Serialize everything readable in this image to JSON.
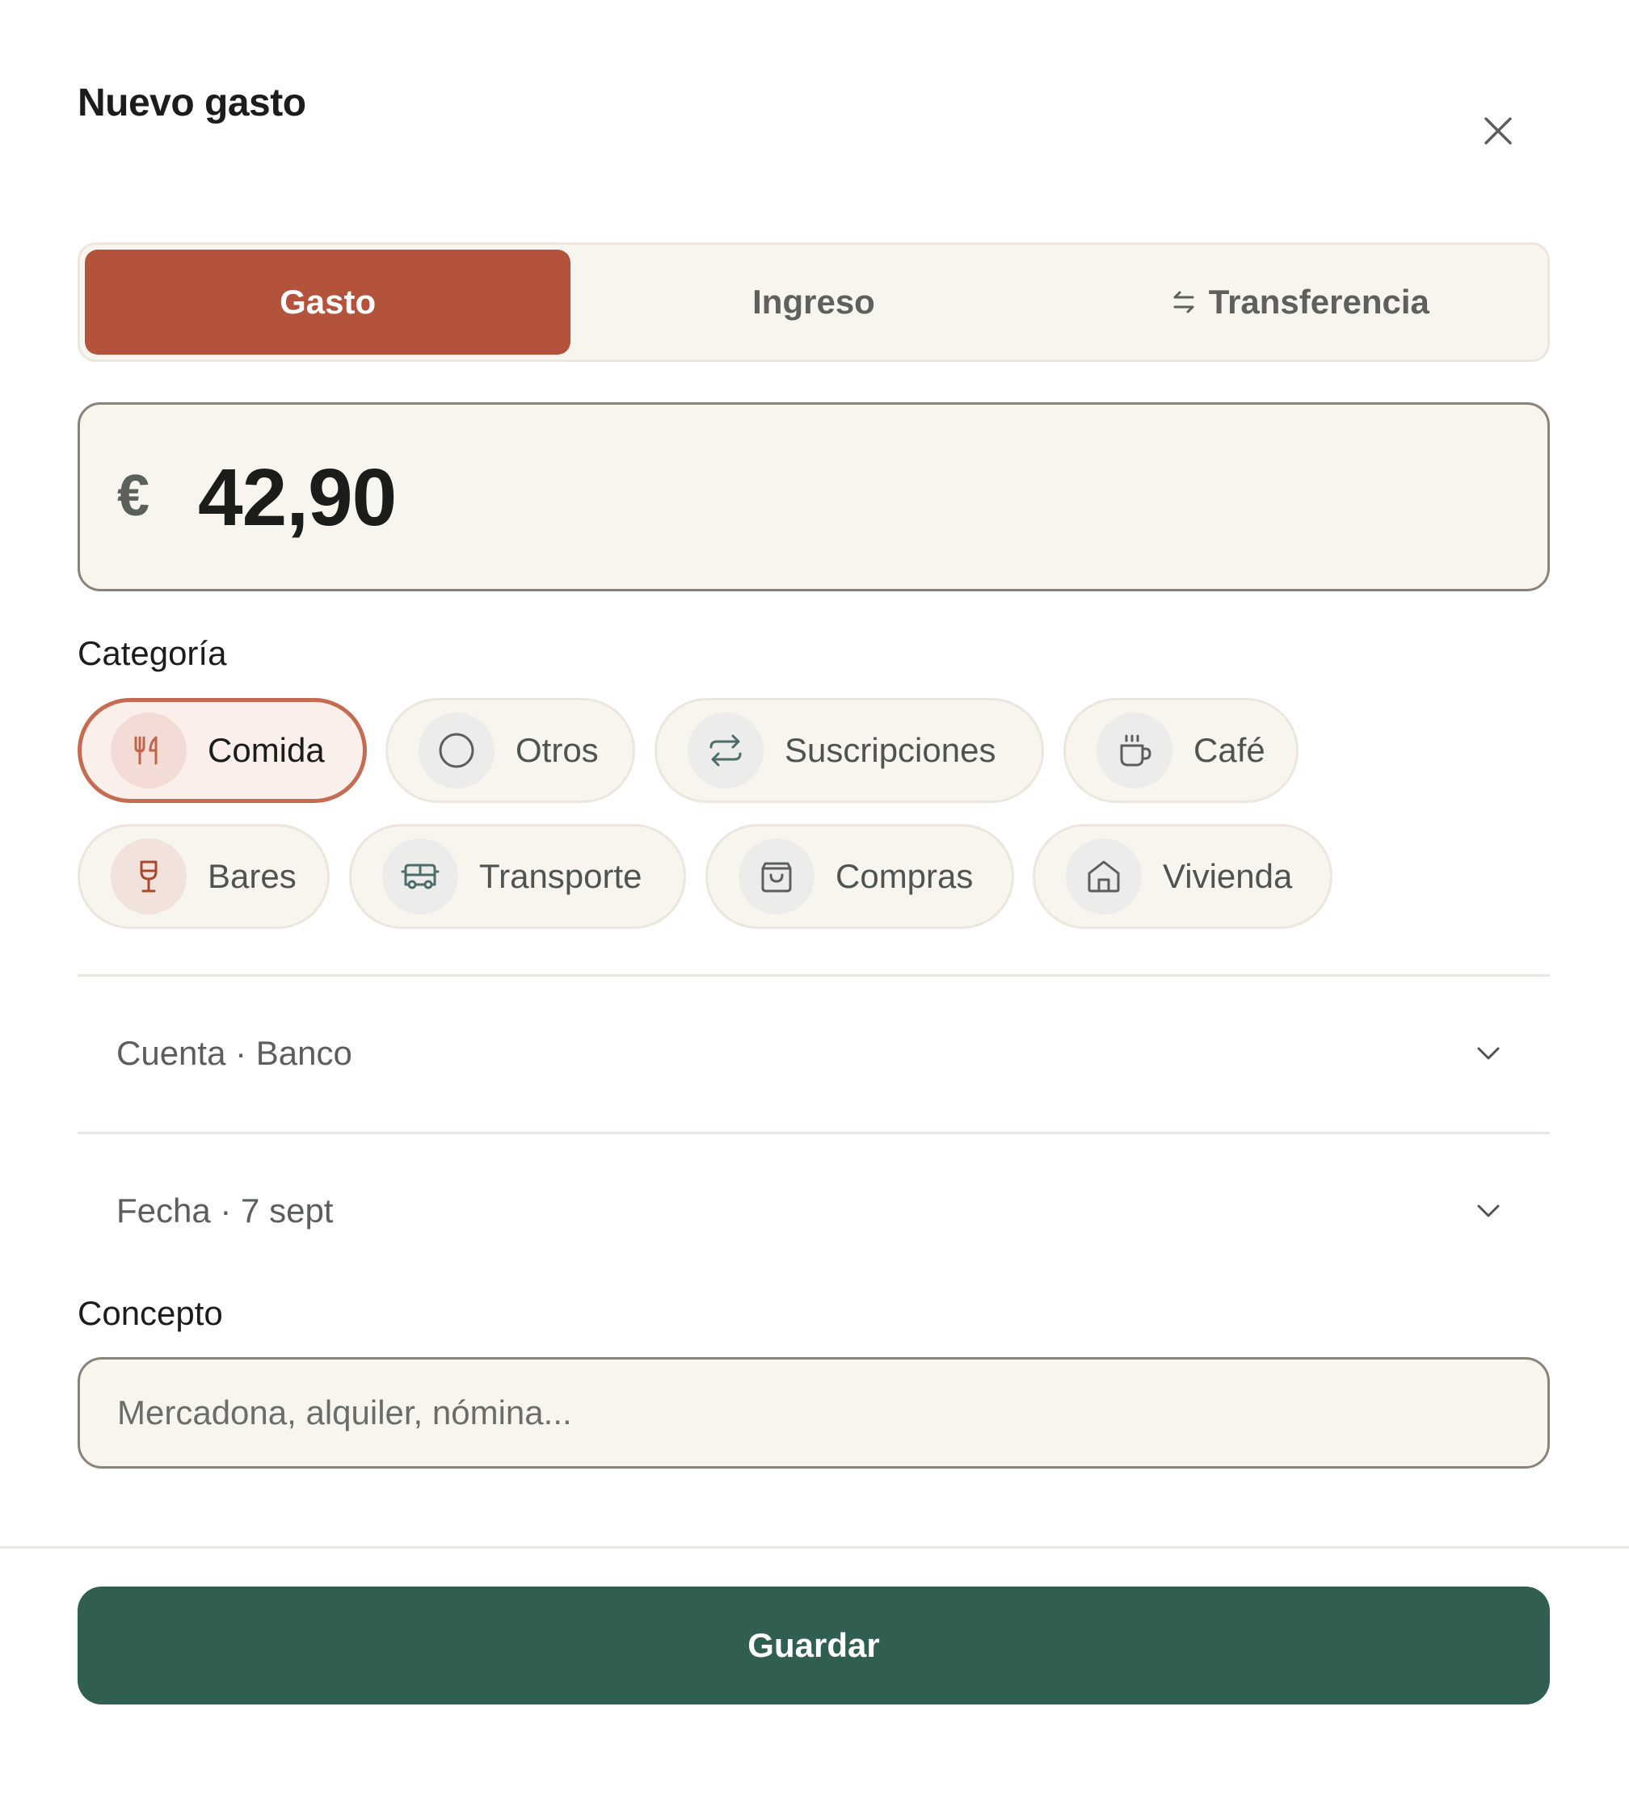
{
  "dialog": {
    "title": "Nuevo gasto"
  },
  "type_tabs": [
    {
      "label": "Gasto",
      "selected": true
    },
    {
      "label": "Ingreso",
      "selected": false
    },
    {
      "label": "Transferencia",
      "selected": false,
      "icon": "swap-arrows-icon"
    }
  ],
  "amount": {
    "currency": "€",
    "value": "42,90"
  },
  "category": {
    "label": "Categoría",
    "items": [
      {
        "label": "Comida",
        "icon": "fork-knife-icon",
        "selected": true
      },
      {
        "label": "Otros",
        "icon": "circle-icon",
        "selected": false
      },
      {
        "label": "Suscripciones",
        "icon": "repeat-icon",
        "selected": false
      },
      {
        "label": "Café",
        "icon": "coffee-cup-icon",
        "selected": false
      },
      {
        "label": "Bares",
        "icon": "wine-glass-icon",
        "selected": false
      },
      {
        "label": "Transporte",
        "icon": "bus-icon",
        "selected": false
      },
      {
        "label": "Compras",
        "icon": "shopping-bag-icon",
        "selected": false
      },
      {
        "label": "Vivienda",
        "icon": "house-icon",
        "selected": false
      }
    ]
  },
  "account": {
    "text": "Cuenta · Banco"
  },
  "date": {
    "text": "Fecha · 7 sept"
  },
  "concept": {
    "label": "Concepto",
    "placeholder": "Mercadona, alquiler, nómina..."
  },
  "save_label": "Guardar",
  "colors": {
    "accent": "#b3533b",
    "primary": "#305e51",
    "surface": "#f8f5ef",
    "selected_chip_border": "#c56b52"
  }
}
